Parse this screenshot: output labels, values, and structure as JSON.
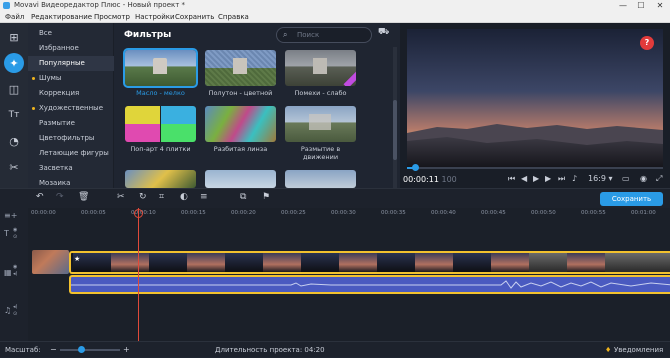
{
  "window": {
    "title": "Movavi Видеоредактор Плюс - Новый проект *",
    "minimize": "—",
    "maximize": "☐",
    "close": "✕"
  },
  "menu": [
    "Файл",
    "Редактирование",
    "Просмотр",
    "Настройки",
    "Сохранить",
    "Справка"
  ],
  "rail": {
    "items": [
      {
        "name": "import-icon",
        "glyph": "⊞"
      },
      {
        "name": "filters-icon",
        "glyph": "✦"
      },
      {
        "name": "transitions-icon",
        "glyph": "◫"
      },
      {
        "name": "titles-icon",
        "glyph": "Tт"
      },
      {
        "name": "stickers-icon",
        "glyph": "◔"
      },
      {
        "name": "tools-icon",
        "glyph": "✂"
      }
    ]
  },
  "categories": {
    "items": [
      "Все",
      "Избранное",
      "Популярные",
      "Шумы",
      "Коррекция",
      "Художественные",
      "Размытие",
      "Цветофильтры",
      "Летающие фигуры",
      "Засветка",
      "Мозаика"
    ],
    "active": "Популярные"
  },
  "filters": {
    "title": "Фильтры",
    "search_placeholder": "Поиск",
    "cards": [
      {
        "label": "Масло - мелко",
        "selected": true,
        "premium": false
      },
      {
        "label": "Полутон - цветной",
        "selected": false,
        "premium": false
      },
      {
        "label": "Помехи - слабо",
        "selected": false,
        "premium": true
      },
      {
        "label": "Поп-арт 4 плитки",
        "selected": false,
        "premium": false
      },
      {
        "label": "Разбитая линза",
        "selected": false,
        "premium": false
      },
      {
        "label": "Размытие в\nдвижении",
        "selected": false,
        "premium": false
      },
      {
        "label": "",
        "selected": false,
        "premium": false
      },
      {
        "label": "",
        "selected": false,
        "premium": false
      },
      {
        "label": "",
        "selected": false,
        "premium": false
      }
    ]
  },
  "player": {
    "help": "?",
    "time_current": "00:00:11",
    "time_frames": "100",
    "aspect": "16:9 ▾",
    "progress_fraction": 0.03
  },
  "toolbar": {
    "save_label": "Сохранить"
  },
  "timeline": {
    "ruler": [
      "00:00:00",
      "00:00:05",
      "00:00:10",
      "00:00:15",
      "00:00:20",
      "00:00:25",
      "00:00:30",
      "00:00:35",
      "00:00:40",
      "00:00:45",
      "00:00:50",
      "00:00:55",
      "00:01:00"
    ]
  },
  "status": {
    "zoom_label": "Масштаб:",
    "duration_label": "Длительность проекта: 04:20",
    "notifications": "Уведомления",
    "zoom_fraction": 0.6
  },
  "colors": {
    "accent": "#2a9be6",
    "track_border": "#f2c12e",
    "playhead": "#e04a3a",
    "premium": "#c04be0"
  }
}
